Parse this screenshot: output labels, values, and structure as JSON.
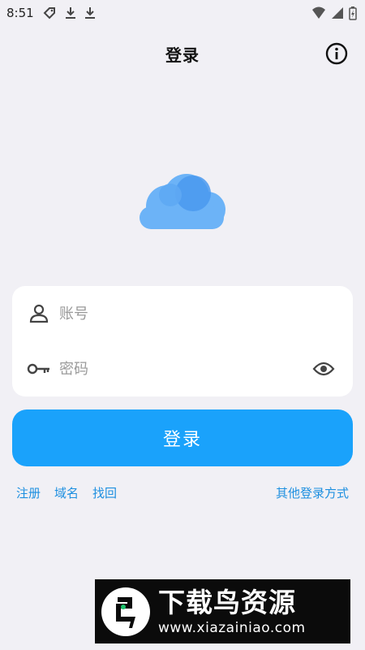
{
  "status_bar": {
    "time": "8:51"
  },
  "header": {
    "title": "登录",
    "info_icon": "info-circle-icon"
  },
  "logo": {
    "icon": "cloud-icon",
    "color": "#5aa7f5"
  },
  "form": {
    "account": {
      "icon": "user-icon",
      "placeholder": "账号",
      "value": ""
    },
    "password": {
      "icon": "key-icon",
      "placeholder": "密码",
      "value": "",
      "toggle_icon": "eye-icon"
    }
  },
  "login_button": {
    "label": "登录",
    "color": "#1aa2fb"
  },
  "links": {
    "register": "注册",
    "domain": "域名",
    "recover": "找回",
    "other_login": "其他登录方式"
  },
  "watermark": {
    "title": "下载鸟资源",
    "url": "www.xiazainiao.com"
  }
}
